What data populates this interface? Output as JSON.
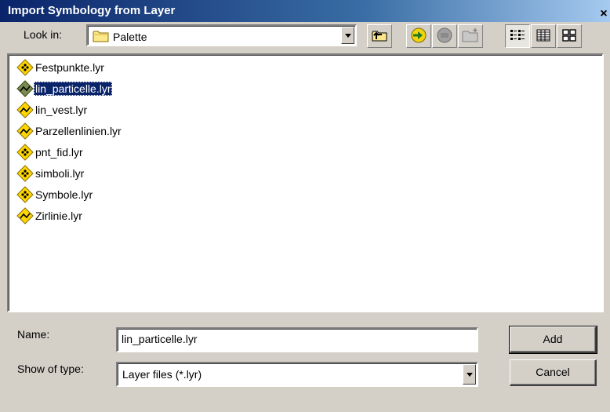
{
  "window": {
    "title": "Import Symbology from Layer",
    "close_label": "×"
  },
  "lookin": {
    "label": "Look in:",
    "value": "Palette"
  },
  "toolbar": {
    "icons": [
      "up-one-level-icon",
      "connect-folder-icon",
      "disconnect-folder-icon",
      "new-folder-icon",
      "list-view-icon",
      "details-view-icon",
      "thumbnails-view-icon"
    ]
  },
  "files": [
    {
      "name": "Festpunkte.lyr",
      "icon": "point-layer-icon",
      "selected": false
    },
    {
      "name": "lin_particelle.lyr",
      "icon": "line-layer-icon",
      "selected": true
    },
    {
      "name": "lin_vest.lyr",
      "icon": "line-layer-icon",
      "selected": false
    },
    {
      "name": "Parzellenlinien.lyr",
      "icon": "line-layer-icon",
      "selected": false
    },
    {
      "name": "pnt_fid.lyr",
      "icon": "point-layer-icon",
      "selected": false
    },
    {
      "name": "simboli.lyr",
      "icon": "point-layer-icon",
      "selected": false
    },
    {
      "name": "Symbole.lyr",
      "icon": "point-layer-icon",
      "selected": false
    },
    {
      "name": "Zirlinie.lyr",
      "icon": "line-layer-icon",
      "selected": false
    }
  ],
  "name_field": {
    "label": "Name:",
    "value": "lin_particelle.lyr"
  },
  "type_field": {
    "label": "Show of type:",
    "value": "Layer files (*.lyr)"
  },
  "buttons": {
    "add": "Add",
    "cancel": "Cancel"
  },
  "colors": {
    "title_bar": "#0a246a",
    "dialog_bg": "#d4d0c8",
    "selection": "#0a246a",
    "layer_icon_yellow": "#ffd700"
  }
}
